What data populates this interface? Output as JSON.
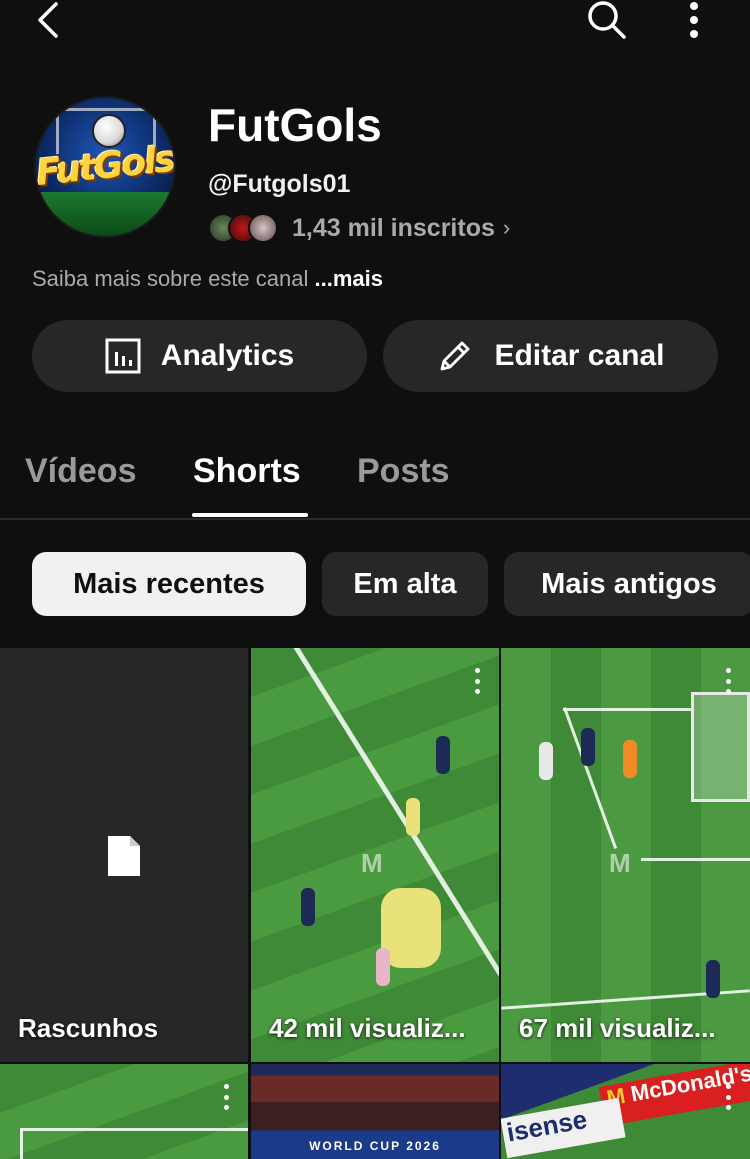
{
  "header": {
    "back_icon": "chevron-left-icon",
    "search_icon": "search-icon",
    "more_icon": "more-vertical-icon"
  },
  "channel": {
    "avatar_text": "FutGols",
    "name": "FutGols",
    "handle": "@Futgols01",
    "subscribers": "1,43 mil inscritos",
    "about": "Saiba mais sobre este canal",
    "about_more": "...mais"
  },
  "actions": {
    "analytics_label": "Analytics",
    "edit_label": "Editar canal"
  },
  "tabs": [
    {
      "label": "Vídeos",
      "active": false
    },
    {
      "label": "Shorts",
      "active": true
    },
    {
      "label": "Posts",
      "active": false
    }
  ],
  "filters": [
    {
      "label": "Mais recentes",
      "active": true
    },
    {
      "label": "Em alta",
      "active": false
    },
    {
      "label": "Mais antigos",
      "active": false
    }
  ],
  "grid": {
    "drafts_label": "Rascunhos",
    "items": [
      {
        "views": "42 mil visualiz..."
      },
      {
        "views": "67 mil visualiz..."
      }
    ],
    "bottom_row_text": {
      "brand": "McDonald's",
      "ad": "isense",
      "ad_text_right": "WORLD CUP 2026"
    }
  },
  "colors": {
    "background": "#0f0f0f",
    "surface": "#272727",
    "muted_text": "#aaaaaa",
    "active_chip": "#f1f1f1"
  }
}
